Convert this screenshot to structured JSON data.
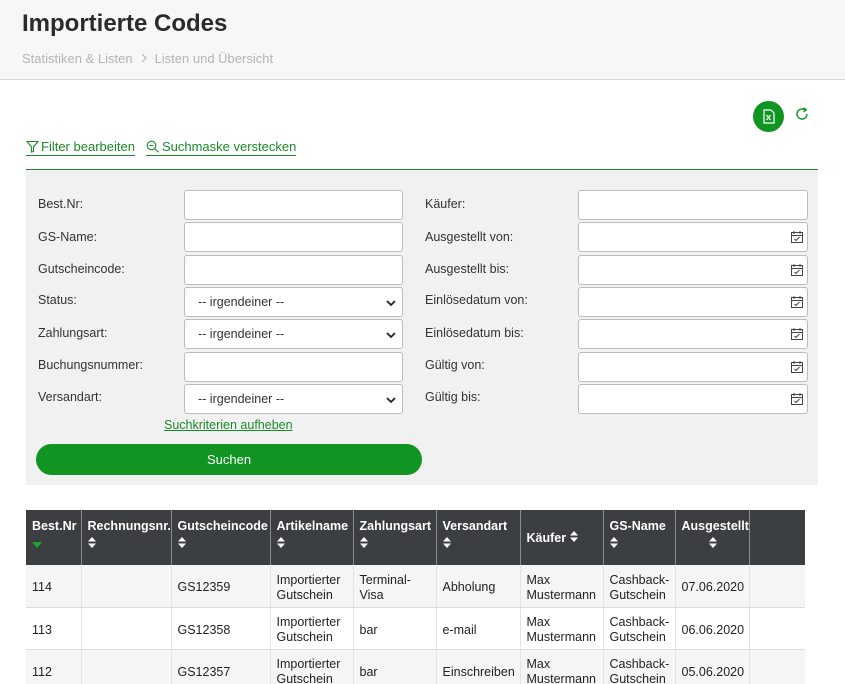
{
  "header": {
    "title": "Importierte Codes",
    "breadcrumb": [
      "Statistiken & Listen",
      "Listen und Übersicht"
    ]
  },
  "toolbar": {
    "excel_icon": "excel-export-icon",
    "refresh_icon": "refresh-icon"
  },
  "filter_links": {
    "edit_filter": "Filter bearbeiten",
    "hide_search": "Suchmaske verstecken"
  },
  "search_form": {
    "left": {
      "best_nr": "Best.Nr:",
      "gs_name": "GS-Name:",
      "gutscheincode": "Gutscheincode:",
      "status": "Status:",
      "zahlungsart": "Zahlungsart:",
      "buchungsnummer": "Buchungsnummer:",
      "versandart": "Versandart:"
    },
    "right": {
      "kaeufer": "Käufer:",
      "ausgestellt_von": "Ausgestellt von:",
      "ausgestellt_bis": "Ausgestellt bis:",
      "einloese_von": "Einlösedatum von:",
      "einloese_bis": "Einlösedatum bis:",
      "gueltig_von": "Gültig von:",
      "gueltig_bis": "Gültig bis:"
    },
    "select_default": "-- irgendeiner --",
    "clear_label": "Suchkriterien aufheben",
    "search_label": "Suchen"
  },
  "table": {
    "columns": [
      "Best.Nr",
      "Rechnungsnr.",
      "Gutscheincode",
      "Artikelname",
      "Zahlungsart",
      "Versandart",
      "Käufer",
      "GS-Name",
      "Ausgestellt"
    ],
    "rows": [
      {
        "best_nr": "114",
        "rechnungsnr": "",
        "code": "GS12359",
        "artikel": [
          "Importierter",
          "Gutschein"
        ],
        "zahlung": [
          "Terminal-",
          "Visa"
        ],
        "versand": "Abholung",
        "kaeufer": [
          "Max",
          "Mustermann"
        ],
        "gs_name": [
          "Cashback-",
          "Gutschein"
        ],
        "ausgestellt": "07.06.2020"
      },
      {
        "best_nr": "113",
        "rechnungsnr": "",
        "code": "GS12358",
        "artikel": [
          "Importierter",
          "Gutschein"
        ],
        "zahlung": [
          "bar",
          ""
        ],
        "versand": "e-mail",
        "kaeufer": [
          "Max",
          "Mustermann"
        ],
        "gs_name": [
          "Cashback-",
          "Gutschein"
        ],
        "ausgestellt": "06.06.2020"
      },
      {
        "best_nr": "112",
        "rechnungsnr": "",
        "code": "GS12357",
        "artikel": [
          "Importierter",
          "Gutschein"
        ],
        "zahlung": [
          "bar",
          ""
        ],
        "versand": "Einschreiben",
        "kaeufer": [
          "Max",
          "Mustermann"
        ],
        "gs_name": [
          "Cashback-",
          "Gutschein"
        ],
        "ausgestellt": "05.06.2020"
      }
    ]
  },
  "colors": {
    "accent": "#109422",
    "link": "#1a8a2a",
    "table_header": "#3b3f41"
  }
}
